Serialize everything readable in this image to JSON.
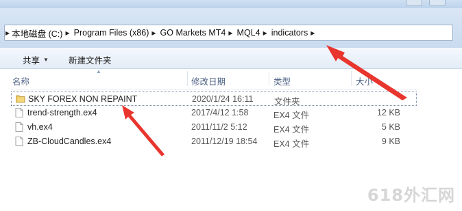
{
  "breadcrumbs": [
    "本地磁盘 (C:)",
    "Program Files (x86)",
    "GO Markets MT4",
    "MQL4",
    "indicators"
  ],
  "toolbar": {
    "share_label": "共享",
    "new_folder_label": "新建文件夹"
  },
  "columns": {
    "name": "名称",
    "date_modified": "修改日期",
    "type": "类型",
    "size": "大小"
  },
  "files": [
    {
      "name": "SKY FOREX NON REPAINT",
      "date": "2020/1/24 16:11",
      "type": "文件夹",
      "size": "",
      "kind": "folder",
      "selected": true
    },
    {
      "name": "trend-strength.ex4",
      "date": "2017/4/12 1:58",
      "type": "EX4 文件",
      "size": "12 KB",
      "kind": "file",
      "selected": false
    },
    {
      "name": "vh.ex4",
      "date": "2011/11/2 5:12",
      "type": "EX4 文件",
      "size": "5 KB",
      "kind": "file",
      "selected": false
    },
    {
      "name": "ZB-CloudCandles.ex4",
      "date": "2011/12/19 18:54",
      "type": "EX4 文件",
      "size": "9 KB",
      "kind": "file",
      "selected": false
    }
  ],
  "watermark": "618外汇网",
  "colors": {
    "annotation_arrow": "#e8352e",
    "folder_icon": "#e9c35a",
    "header_text": "#4d6185"
  }
}
